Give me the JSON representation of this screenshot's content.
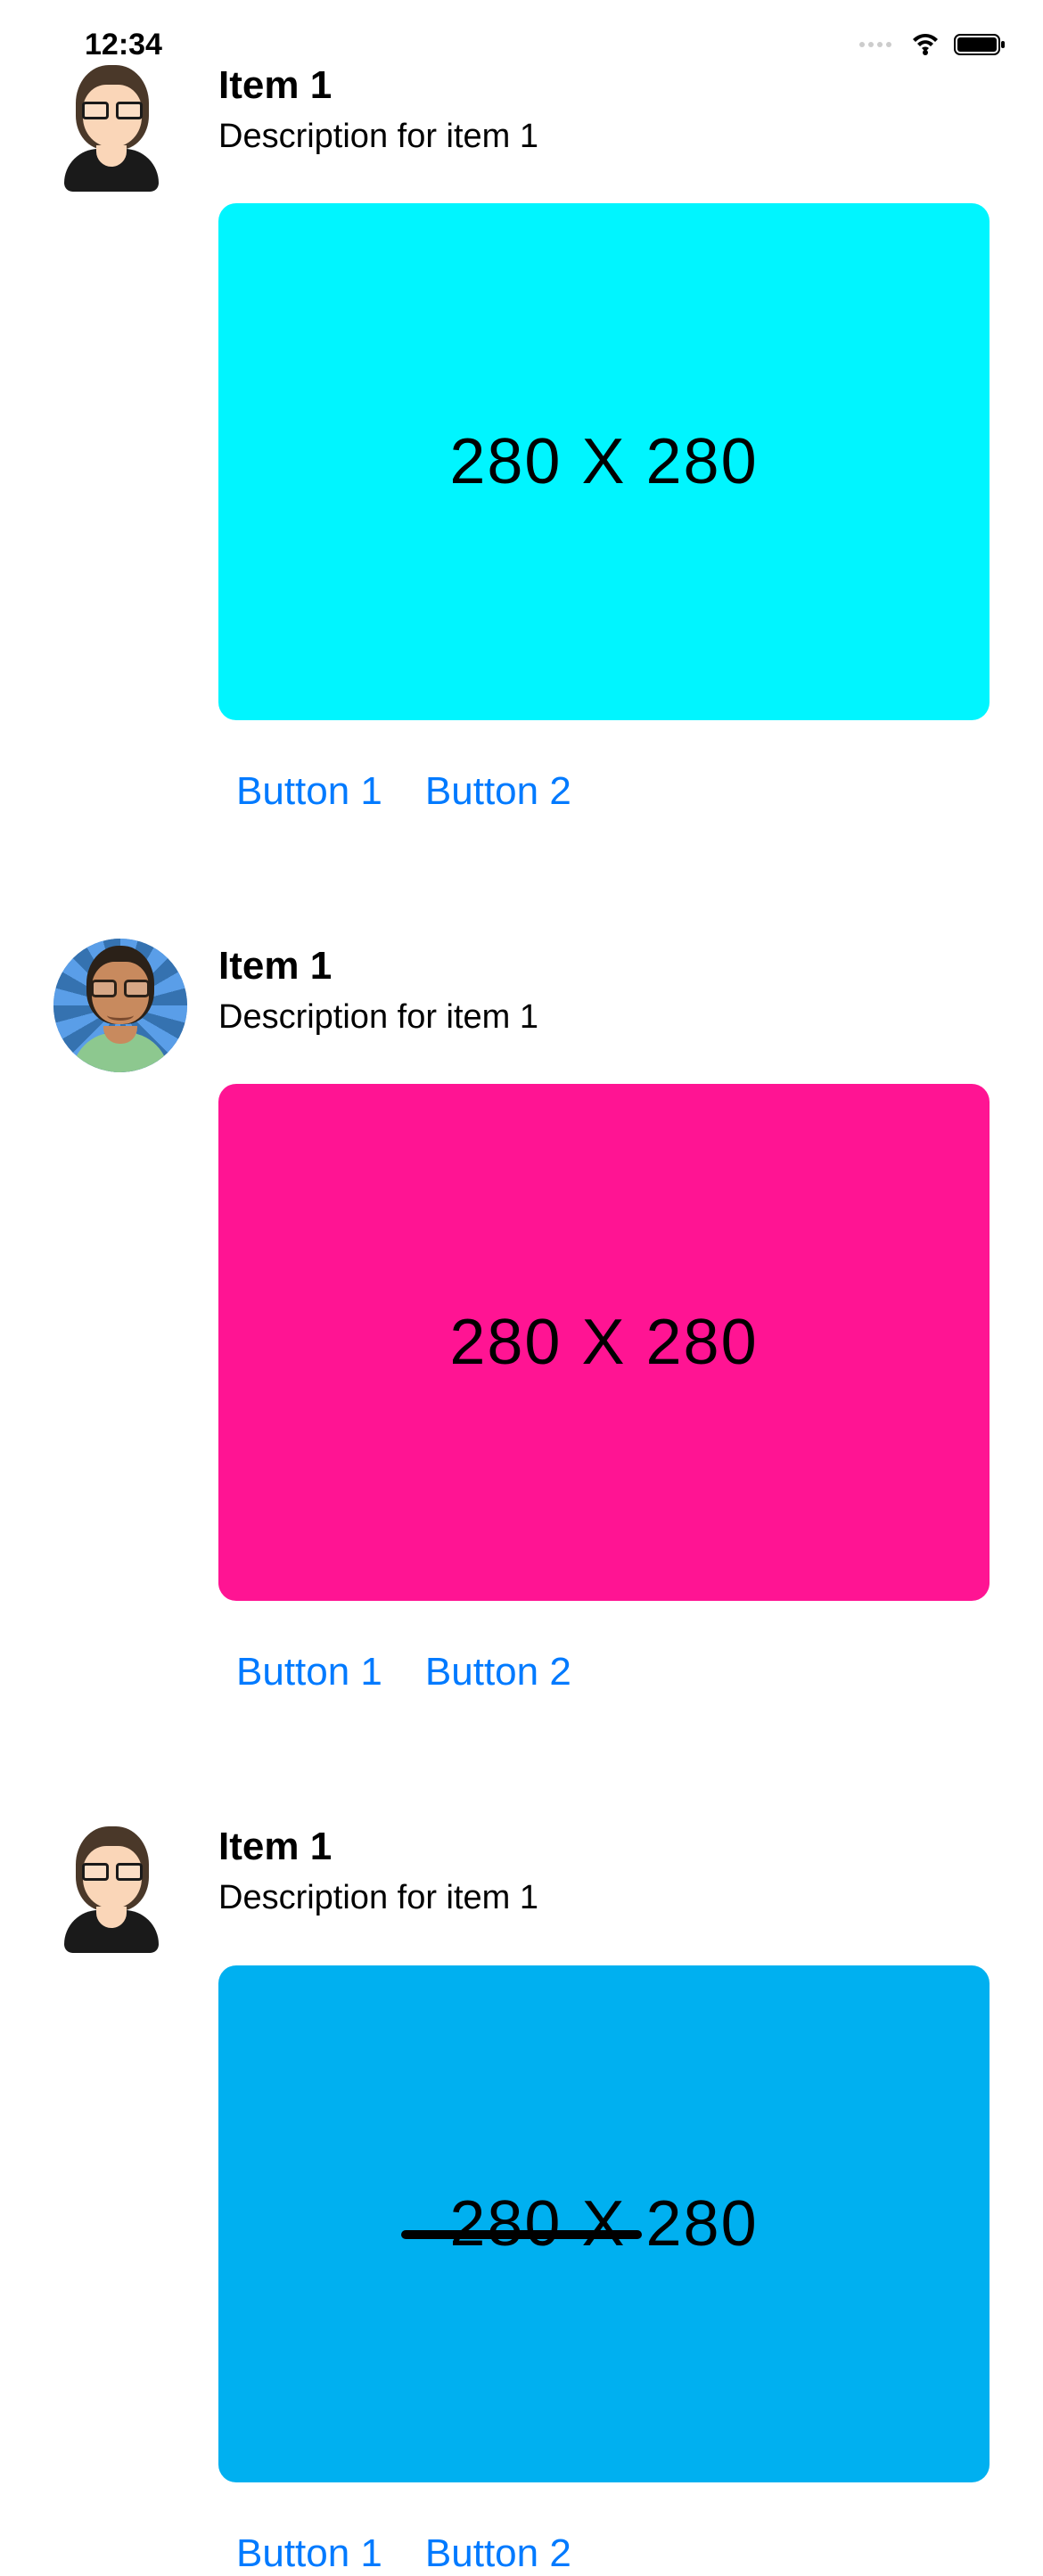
{
  "status": {
    "time": "12:34"
  },
  "feed": {
    "items": [
      {
        "title": "Item 1",
        "description": "Description for item 1",
        "image_label": "280 X 280",
        "image_color": "#00f5ff",
        "buttons": [
          "Button 1",
          "Button 2"
        ]
      },
      {
        "title": "Item 1",
        "description": "Description for item 1",
        "image_label": "280 X 280",
        "image_color": "#ff1493",
        "buttons": [
          "Button 1",
          "Button 2"
        ]
      },
      {
        "title": "Item 1",
        "description": "Description for item 1",
        "image_label": "280 X 280",
        "image_color": "#00b0f0",
        "buttons": [
          "Button 1",
          "Button 2"
        ]
      }
    ]
  }
}
